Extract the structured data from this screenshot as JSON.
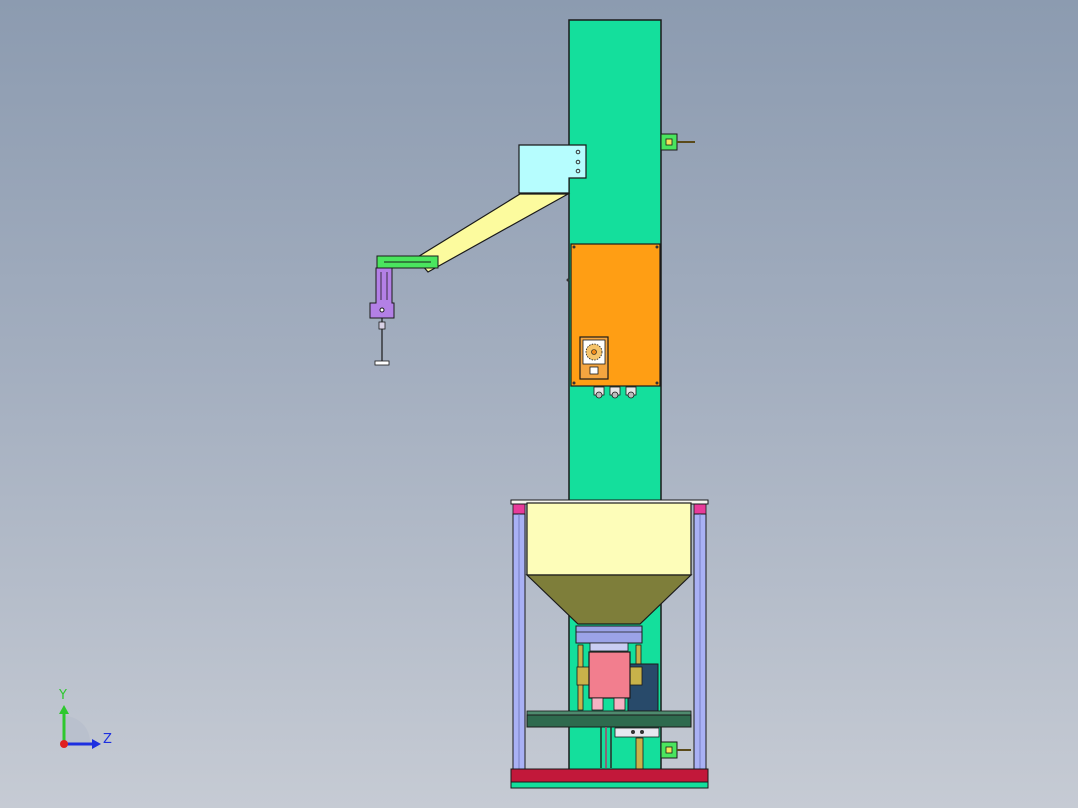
{
  "viewport": {
    "background_top": "#8c9bb0",
    "background_bottom": "#c6cbd4"
  },
  "triad": {
    "y_label": "Y",
    "z_label": "Z",
    "y_color": "#2ec82e",
    "z_color": "#1d2fe0",
    "x_color": "#e02020"
  },
  "colors": {
    "column": "#14df9c",
    "control_box": "#ff9e14",
    "chute_mount": "#b6fdfe",
    "chute": "#fcfb9e",
    "arm_bracket": "#4ae55e",
    "arm_link": "#b380e6",
    "hopper_top": "#fdfdb9",
    "hopper_cone": "#7e7e3a",
    "flange": "#9ba3e8",
    "valve_body": "#f27e8e",
    "motor": "#284a6a",
    "crossbeam": "#2e6a4e",
    "leg": "#a9b1f5",
    "leg_cap": "#e83b9a",
    "base_rail": "#c2183a",
    "outline": "#1a1a1a"
  },
  "icons": {
    "dial": "dial-icon",
    "gland": "cable-gland-icon",
    "axis_triad": "axis-triad-icon"
  }
}
